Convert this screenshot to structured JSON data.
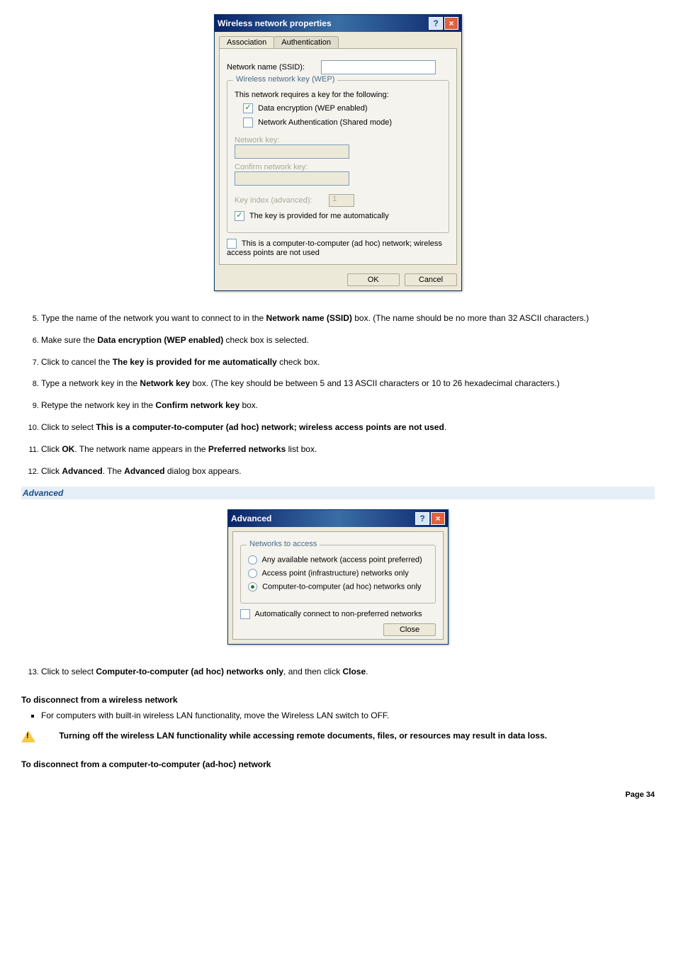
{
  "dialog1": {
    "title": "Wireless network properties",
    "tabs": {
      "assoc": "Association",
      "auth": "Authentication"
    },
    "ssid_label": "Network name (SSID):",
    "wep_legend": "Wireless network key (WEP)",
    "requires": "This network requires a key for the following:",
    "chk_data_enc": "Data encryption (WEP enabled)",
    "chk_net_auth": "Network Authentication (Shared mode)",
    "netkey_label": "Network key:",
    "confirm_label": "Confirm network key:",
    "keyindex_label": "Key index (advanced):",
    "keyindex_val": "1",
    "chk_auto": "The key is provided for me automatically",
    "chk_adhoc": "This is a computer-to-computer (ad hoc) network; wireless access points are not used",
    "ok": "OK",
    "cancel": "Cancel"
  },
  "steps1": {
    "s5a": "Type the name of the network you want to connect to in the ",
    "s5b": "Network name (SSID)",
    "s5c": " box. (The name should be no more than 32 ASCII characters.)",
    "s6a": "Make sure the ",
    "s6b": "Data encryption (WEP enabled)",
    "s6c": " check box is selected.",
    "s7a": "Click to cancel the ",
    "s7b": "The key is provided for me automatically",
    "s7c": " check box.",
    "s8a": "Type a network key in the ",
    "s8b": "Network key",
    "s8c": " box. (The key should be between 5 and 13 ASCII characters or 10 to 26 hexadecimal characters.)",
    "s9a": "Retype the network key in the ",
    "s9b": "Confirm network key",
    "s9c": " box.",
    "s10a": "Click to select ",
    "s10b": "This is a computer-to-computer (ad hoc) network; wireless access points are not used",
    "s10c": ".",
    "s11a": "Click ",
    "s11b": "OK",
    "s11c": ". The network name appears in the ",
    "s11d": "Preferred networks",
    "s11e": " list box.",
    "s12a": "Click ",
    "s12b": "Advanced",
    "s12c": ". The ",
    "s12d": "Advanced",
    "s12e": " dialog box appears."
  },
  "advanced_hdr": "Advanced",
  "dialog2": {
    "title": "Advanced",
    "legend": "Networks to access",
    "r1": "Any available network (access point preferred)",
    "r2": "Access point (infrastructure) networks only",
    "r3": "Computer-to-computer (ad hoc) networks only",
    "chk": "Automatically connect to non-preferred networks",
    "close": "Close"
  },
  "steps2": {
    "s13a": "Click to select ",
    "s13b": "Computer-to-computer (ad hoc) networks only",
    "s13c": ", and then click ",
    "s13d": "Close",
    "s13e": "."
  },
  "disconnect1_hdr": "To disconnect from a wireless network",
  "disconnect1_bul": "For computers with built-in wireless LAN functionality, move the Wireless LAN switch to OFF.",
  "warning_text": "Turning off the wireless LAN functionality while accessing remote documents, files, or resources may result in data loss.",
  "disconnect2_hdr": "To disconnect from a computer-to-computer (ad-hoc) network",
  "page_num": "Page 34"
}
